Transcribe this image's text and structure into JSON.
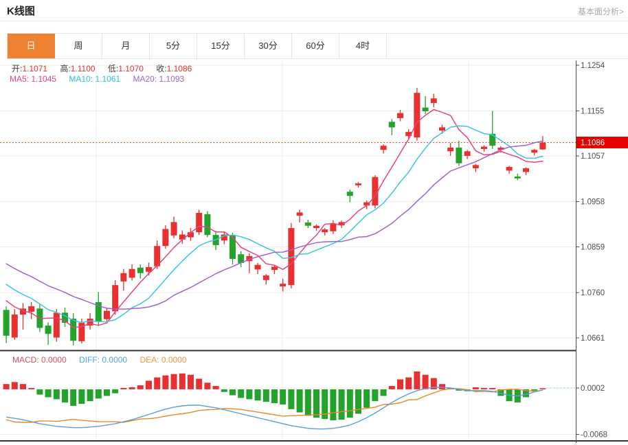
{
  "header": {
    "title": "K线图",
    "link_label": "基本面分析>"
  },
  "tabs": {
    "items": [
      {
        "label": "日",
        "selected": true
      },
      {
        "label": "周",
        "selected": false
      },
      {
        "label": "月",
        "selected": false
      },
      {
        "label": "5分",
        "selected": false
      },
      {
        "label": "15分",
        "selected": false
      },
      {
        "label": "30分",
        "selected": false
      },
      {
        "label": "60分",
        "selected": false
      },
      {
        "label": "4时",
        "selected": false
      }
    ]
  },
  "overlay": {
    "ohlc": [
      {
        "label": "开:",
        "value": "1.1071"
      },
      {
        "label": "高:",
        "value": "1.1100"
      },
      {
        "label": "低:",
        "value": "1.1070"
      },
      {
        "label": "收:",
        "value": "1.1086"
      }
    ],
    "ma": [
      {
        "label": "MA5:",
        "value": "1.1045",
        "color": "#e8437b"
      },
      {
        "label": "MA10:",
        "value": "1.1061",
        "color": "#2ec0d8"
      },
      {
        "label": "MA20:",
        "value": "1.1093",
        "color": "#a064cc"
      }
    ]
  },
  "macd_header": [
    {
      "label": "MACD:",
      "value": "0.0000",
      "color": "#e04a5f"
    },
    {
      "label": "DIFF:",
      "value": "0.0000",
      "color": "#54a0e8"
    },
    {
      "label": "DEA:",
      "value": "0.0000",
      "color": "#f5953b"
    }
  ],
  "chart_data": {
    "type": "candlestick+macd",
    "price_axis": {
      "domain": [
        1.06344,
        1.12645
      ],
      "ticks": [
        {
          "label": "1.1254",
          "value": 1.1254
        },
        {
          "label": "1.1155",
          "value": 1.1155
        },
        {
          "label": "1.1057",
          "value": 1.1057
        },
        {
          "label": "1.0958",
          "value": 1.0958
        },
        {
          "label": "1.0859",
          "value": 1.0859
        },
        {
          "label": "1.0760",
          "value": 1.076
        },
        {
          "label": "1.0661",
          "value": 1.0661
        }
      ],
      "current_price": {
        "label": "1.1086",
        "value": 1.1086
      }
    },
    "macd_axis": {
      "domain": [
        -0.0077,
        0.0056
      ],
      "ticks": [
        {
          "label": "0.0002",
          "value": 0.0002
        },
        {
          "label": "-0.0068",
          "value": -0.0068
        }
      ]
    },
    "candles": [
      [
        1.0722,
        1.073,
        1.065,
        1.0666
      ],
      [
        1.0662,
        1.0724,
        1.0657,
        1.0712
      ],
      [
        1.0712,
        1.0737,
        1.0679,
        1.0725
      ],
      [
        1.0718,
        1.0739,
        1.0702,
        1.073
      ],
      [
        1.0725,
        1.0734,
        1.0674,
        1.0683
      ],
      [
        1.0688,
        1.0695,
        1.0646,
        1.067
      ],
      [
        1.0662,
        1.0724,
        1.0653,
        1.0716
      ],
      [
        1.0716,
        1.0727,
        1.0685,
        1.0694
      ],
      [
        1.0703,
        1.0715,
        1.0645,
        1.0655
      ],
      [
        1.0654,
        1.0703,
        1.0649,
        1.0694
      ],
      [
        1.0688,
        1.0715,
        1.0679,
        1.0703
      ],
      [
        1.0739,
        1.0761,
        1.0687,
        1.0697
      ],
      [
        1.0702,
        1.0726,
        1.0694,
        1.072
      ],
      [
        1.0719,
        1.0787,
        1.0712,
        1.0776
      ],
      [
        1.0784,
        1.0811,
        1.0764,
        1.0802
      ],
      [
        1.0792,
        1.0821,
        1.0786,
        1.0811
      ],
      [
        1.0814,
        1.0821,
        1.079,
        1.0802
      ],
      [
        1.0805,
        1.0825,
        1.0797,
        1.0815
      ],
      [
        1.0817,
        1.0873,
        1.0811,
        1.0861
      ],
      [
        1.0861,
        1.0906,
        1.0855,
        1.0898
      ],
      [
        1.0884,
        1.0925,
        1.0878,
        1.0913
      ],
      [
        1.0875,
        1.0895,
        1.0866,
        1.0886
      ],
      [
        1.088,
        1.09,
        1.0872,
        1.0891
      ],
      [
        1.0891,
        1.094,
        1.0885,
        1.0933
      ],
      [
        1.093,
        1.0937,
        1.088,
        1.0885
      ],
      [
        1.0885,
        1.0894,
        1.0852,
        1.0863
      ],
      [
        1.0873,
        1.0892,
        1.0865,
        1.0886
      ],
      [
        1.0885,
        1.089,
        1.0821,
        1.0833
      ],
      [
        1.0843,
        1.085,
        1.0815,
        1.0824
      ],
      [
        1.0828,
        1.0845,
        1.0802,
        1.0839
      ],
      [
        1.081,
        1.0824,
        1.08,
        1.082
      ],
      [
        1.0787,
        1.08,
        1.0777,
        1.0797
      ],
      [
        1.0809,
        1.082,
        1.08,
        1.0816
      ],
      [
        1.0773,
        1.079,
        1.0762,
        1.0779
      ],
      [
        1.0776,
        1.0911,
        1.0769,
        1.09
      ],
      [
        1.0927,
        1.094,
        1.0912,
        1.0934
      ],
      [
        1.0912,
        1.0918,
        1.09,
        1.0905
      ],
      [
        1.09,
        1.0908,
        1.0894,
        1.0905
      ],
      [
        1.0891,
        1.09,
        1.0884,
        1.0897
      ],
      [
        1.0893,
        1.0917,
        1.0887,
        1.091
      ],
      [
        1.0906,
        1.0916,
        1.09,
        1.0913
      ],
      [
        1.0979,
        1.0984,
        1.0956,
        1.097
      ],
      [
        1.0993,
        1.1,
        1.0988,
        1.0997
      ],
      [
        1.0949,
        1.096,
        1.0941,
        1.0956
      ],
      [
        1.0949,
        1.1015,
        1.0943,
        1.1011
      ],
      [
        1.107,
        1.1082,
        1.1062,
        1.1079
      ],
      [
        1.1131,
        1.1137,
        1.1102,
        1.1119
      ],
      [
        1.1139,
        1.1157,
        1.1132,
        1.115
      ],
      [
        1.11,
        1.1115,
        1.1092,
        1.1109
      ],
      [
        1.1097,
        1.1205,
        1.109,
        1.1194
      ],
      [
        1.1162,
        1.1187,
        1.1148,
        1.1154
      ],
      [
        1.1172,
        1.1192,
        1.1163,
        1.1182
      ],
      [
        1.1112,
        1.1125,
        1.1105,
        1.1119
      ],
      [
        1.1067,
        1.1085,
        1.1057,
        1.1075
      ],
      [
        1.1075,
        1.109,
        1.1035,
        1.1041
      ],
      [
        1.1057,
        1.107,
        1.105,
        1.1067
      ],
      [
        1.103,
        1.104,
        1.1022,
        1.1037
      ],
      [
        1.1072,
        1.108,
        1.1066,
        1.1077
      ],
      [
        1.1105,
        1.1155,
        1.1072,
        1.1079
      ],
      [
        1.107,
        1.1078,
        1.1064,
        1.1075
      ],
      [
        1.1025,
        1.1035,
        1.1018,
        1.1033
      ],
      [
        1.1012,
        1.1018,
        1.1004,
        1.1008
      ],
      [
        1.1022,
        1.1032,
        1.1015,
        1.103
      ],
      [
        1.1064,
        1.1072,
        1.1058,
        1.107
      ],
      [
        1.1071,
        1.11,
        1.107,
        1.1086
      ]
    ],
    "ma_periods": [
      5,
      10,
      20
    ],
    "ma_prehistory_closes": [
      1.094,
      1.0925,
      1.091,
      1.0896,
      1.0882,
      1.0868,
      1.0855,
      1.0843,
      1.0832,
      1.0822,
      1.0843,
      1.0834,
      1.0824,
      1.0814,
      1.0803,
      1.0791,
      1.0779,
      1.0767,
      1.0755,
      1.0743
    ],
    "macd_hist": [
      0.0008,
      0.0011,
      0.0008,
      0.0002,
      -0.0008,
      -0.0012,
      -0.0015,
      -0.002,
      -0.0025,
      -0.0022,
      -0.0018,
      -0.0014,
      -0.001,
      -0.0006,
      0.0002,
      0.0003,
      0.0006,
      0.0013,
      0.0018,
      0.0021,
      0.0023,
      0.0024,
      0.0022,
      0.0016,
      0.001,
      0.0005,
      -0.0004,
      -0.0009,
      -0.0013,
      -0.0015,
      -0.0017,
      -0.0019,
      -0.0021,
      -0.0023,
      -0.003,
      -0.0035,
      -0.004,
      -0.0043,
      -0.0045,
      -0.0047,
      -0.0046,
      -0.0043,
      -0.0037,
      -0.0028,
      -0.0018,
      -0.001,
      0.0005,
      0.0015,
      0.0018,
      0.0027,
      0.0022,
      0.0017,
      0.0008,
      0.0002,
      -0.0002,
      -0.0003,
      0.0003,
      0.0002,
      0.0002,
      -0.001,
      -0.0018,
      -0.002,
      -0.0012,
      -0.0002,
      0.0001
    ],
    "macd_diff": [
      -0.0042,
      -0.0044,
      -0.0046,
      -0.0049,
      -0.0052,
      -0.0054,
      -0.0056,
      -0.0057,
      -0.0058,
      -0.0058,
      -0.0057,
      -0.0056,
      -0.0054,
      -0.0052,
      -0.0049,
      -0.0046,
      -0.0042,
      -0.0038,
      -0.0034,
      -0.003,
      -0.0027,
      -0.0025,
      -0.0024,
      -0.0024,
      -0.0026,
      -0.0028,
      -0.0031,
      -0.0034,
      -0.0037,
      -0.004,
      -0.0043,
      -0.0046,
      -0.0049,
      -0.0052,
      -0.0055,
      -0.0057,
      -0.0059,
      -0.006,
      -0.006,
      -0.0059,
      -0.0057,
      -0.0054,
      -0.0049,
      -0.0043,
      -0.0036,
      -0.0028,
      -0.002,
      -0.0013,
      -0.0007,
      -0.0002,
      0.0001,
      0.0003,
      0.0003,
      0.0002,
      0.0,
      -0.0002,
      -0.0002,
      -0.0002,
      -0.0003,
      -0.0006,
      -0.0009,
      -0.001,
      -0.0008,
      -0.0004,
      -0.0001
    ],
    "colors": {
      "up": "#e93030",
      "down": "#23a32b",
      "ma5": "#e8437b",
      "ma10": "#3cc6de",
      "ma20": "#a064cc",
      "diff": "#5c9fd6",
      "dea": "#f0861f",
      "grid": "#ececec",
      "axis": "#4a4a4a",
      "tick_text": "#4d4d4d",
      "current_line": "#ff3b30",
      "badge_bg": "#e60000",
      "badge_text": "#ffffff",
      "macd_zero_dash": "#8fd9e8"
    },
    "layout": {
      "grid": true,
      "v_gridlines_x": [
        140,
        411,
        682
      ],
      "plot_right": 838
    }
  }
}
